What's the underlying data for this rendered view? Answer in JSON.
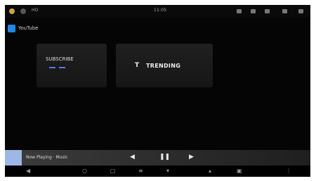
{
  "status_bar": {
    "left_text": "HD",
    "time": "11:05",
    "colors": {
      "left_dot": "#c8a64a",
      "second_dot": "#555555"
    }
  },
  "app": {
    "title": "YouTube",
    "icon": "app-icon"
  },
  "tiles": [
    {
      "label": "SUBSCRIBE"
    },
    {
      "icon": "text-t-icon",
      "label": "TRENDING"
    }
  ],
  "player": {
    "text": "Now Playing · Music",
    "controls": [
      "prev-icon",
      "pause-icon",
      "next-icon"
    ]
  },
  "nav": {
    "icons": [
      "back-icon",
      "home-icon",
      "recents-icon",
      "menu-icon",
      "volume-down-icon",
      "volume-up-icon",
      "screenshot-icon"
    ]
  },
  "colors": {
    "accent": "#1e88e5",
    "underline": "#5a7bd8",
    "player_thumb": "#9db8e6"
  }
}
